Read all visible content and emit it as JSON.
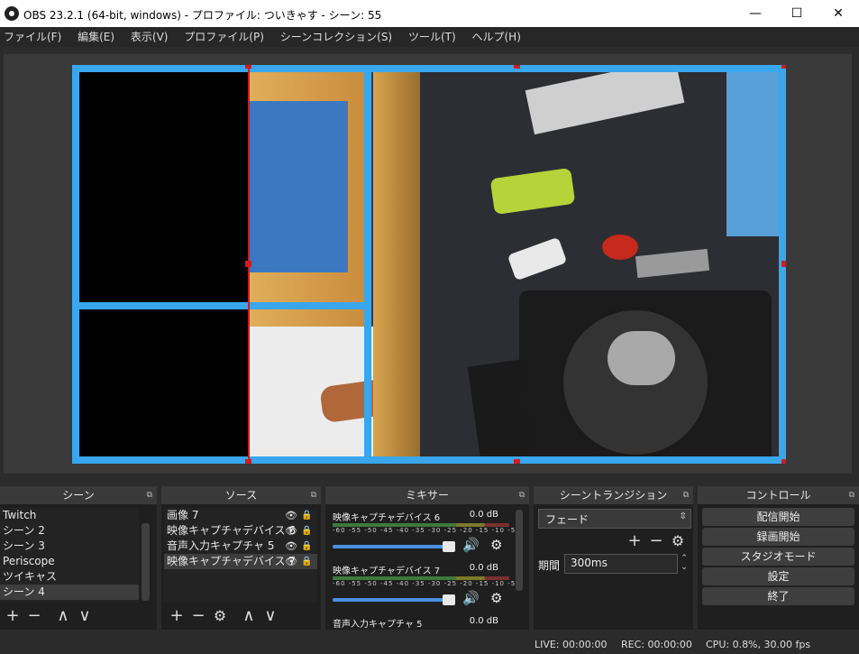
{
  "window": {
    "title": "OBS 23.2.1 (64-bit, windows) - プロファイル: ついきゃす - シーン: 55",
    "minimize": "—",
    "maximize": "☐",
    "close": "✕"
  },
  "menu": [
    "ファイル(F)",
    "編集(E)",
    "表示(V)",
    "プロファイル(P)",
    "シーンコレクション(S)",
    "ツール(T)",
    "ヘルプ(H)"
  ],
  "scenes": {
    "title": "シーン",
    "items": [
      "Twitch",
      "シーン 2",
      "シーン 3",
      "Periscope",
      "ツイキャス",
      "シーン 4"
    ],
    "selected": 5,
    "toolbar": [
      "+",
      "−",
      "∧",
      "∨"
    ]
  },
  "sources": {
    "title": "ソース",
    "items": [
      "画像 7",
      "映像キャプチャデバイス 6",
      "音声入力キャプチャ 5",
      "映像キャプチャデバイス 7"
    ],
    "selected": 3,
    "toolbar": [
      "+",
      "−",
      "⚙",
      "∧",
      "∨"
    ]
  },
  "mixer": {
    "title": "ミキサー",
    "scale": "-60 -55 -50 -45 -40 -35 -30 -25 -20 -15 -10 -5 0",
    "channels": [
      {
        "name": "映像キャプチャデバイス 6",
        "db": "0.0 dB"
      },
      {
        "name": "映像キャプチャデバイス 7",
        "db": "0.0 dB"
      },
      {
        "name": "音声入力キャプチャ 5",
        "db": "0.0 dB"
      }
    ]
  },
  "transitions": {
    "title": "シーントランジション",
    "selected": "フェード",
    "duration_label": "期間",
    "duration": "300ms"
  },
  "controls": {
    "title": "コントロール",
    "buttons": [
      "配信開始",
      "録画開始",
      "スタジオモード",
      "設定",
      "終了"
    ]
  },
  "status": {
    "live": "LIVE: 00:00:00",
    "rec": "REC: 00:00:00",
    "cpu": "CPU: 0.8%, 30.00 fps"
  },
  "colors": {
    "selection_blue": "#3aa6ee",
    "selection_red": "#d01c1c",
    "accent_blue": "#4a90e2"
  },
  "icons": {
    "pin": "⧉",
    "eye": "👁",
    "lock": "🔒",
    "volume": "🔊",
    "gear": "⚙"
  }
}
